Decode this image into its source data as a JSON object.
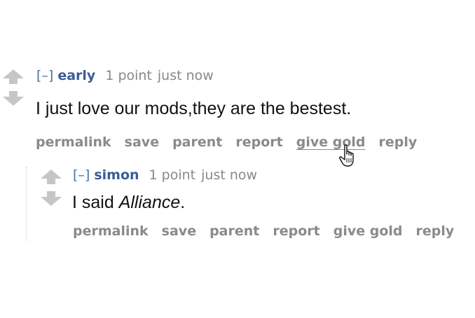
{
  "comments": [
    {
      "toggle": "[–]",
      "author": "early",
      "score": "1 point",
      "time": "just now",
      "body": "I just love our mods,they are the bestest.",
      "body_emphasis": "",
      "body_end": "",
      "buttons": [
        "permalink",
        "save",
        "parent",
        "report",
        "give gold",
        "reply"
      ]
    },
    {
      "toggle": "[–]",
      "author": "simon",
      "score": "1 point",
      "time": "just now",
      "body": "I said ",
      "body_emphasis": "Alliance",
      "body_end": ".",
      "buttons": [
        "permalink",
        "save",
        "parent",
        "report",
        "give gold",
        "reply"
      ]
    }
  ],
  "icons": {
    "upvote": "upvote-arrow-icon",
    "downvote": "downvote-arrow-icon",
    "cursor": "hand-pointer-cursor-icon"
  },
  "colors": {
    "author": "#3a5d96",
    "meta": "#888888",
    "buttons": "#8a8a8a",
    "arrow": "#c6c6c6"
  }
}
